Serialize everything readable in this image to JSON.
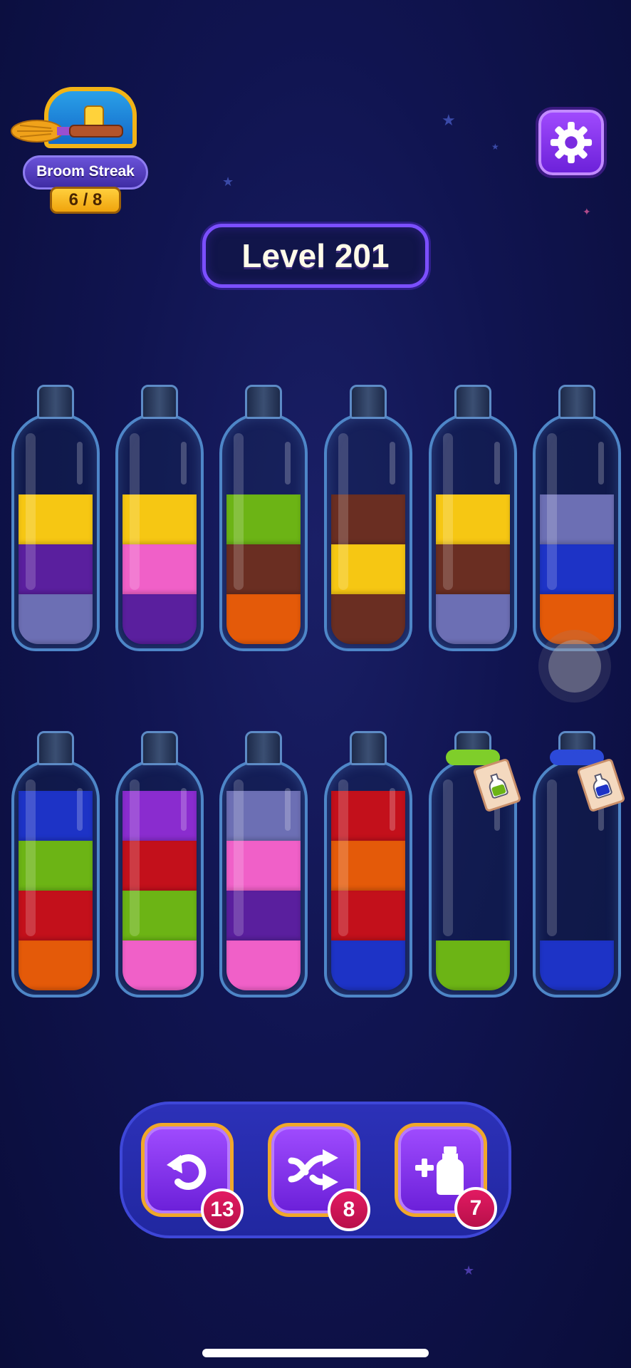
{
  "streak": {
    "label": "Broom Streak",
    "count": "6 / 8"
  },
  "level": {
    "label": "Level 201"
  },
  "colors": {
    "yellow": "#f6c713",
    "purple": "#5a1f9e",
    "periwinkle": "#6c6fb4",
    "pink": "#f060c8",
    "green": "#6cb415",
    "brown": "#6a2e22",
    "orange": "#e45a09",
    "blue": "#1d33c6",
    "red": "#c3101b",
    "violet": "#8a2ccf"
  },
  "bottles": [
    {
      "layers_bottom_to_top": [
        "periwinkle",
        "purple",
        "yellow"
      ]
    },
    {
      "layers_bottom_to_top": [
        "purple",
        "pink",
        "yellow"
      ]
    },
    {
      "layers_bottom_to_top": [
        "orange",
        "brown",
        "green"
      ]
    },
    {
      "layers_bottom_to_top": [
        "brown",
        "yellow",
        "brown"
      ]
    },
    {
      "layers_bottom_to_top": [
        "periwinkle",
        "brown",
        "yellow"
      ]
    },
    {
      "layers_bottom_to_top": [
        "orange",
        "blue",
        "periwinkle"
      ]
    },
    {
      "layers_bottom_to_top": [
        "orange",
        "red",
        "green",
        "blue"
      ]
    },
    {
      "layers_bottom_to_top": [
        "pink",
        "green",
        "red",
        "violet"
      ]
    },
    {
      "layers_bottom_to_top": [
        "pink",
        "purple",
        "pink",
        "periwinkle"
      ]
    },
    {
      "layers_bottom_to_top": [
        "blue",
        "red",
        "orange",
        "red"
      ]
    },
    {
      "layers_bottom_to_top": [
        "green"
      ],
      "tied": true,
      "rope_color": "#7fce2a"
    },
    {
      "layers_bottom_to_top": [
        "blue"
      ],
      "tied": true,
      "rope_color": "#2c49d8"
    }
  ],
  "powerups": {
    "undo": {
      "icon": "undo-icon",
      "count": "13"
    },
    "shuffle": {
      "icon": "shuffle-icon",
      "count": "8"
    },
    "add_bottle": {
      "icon": "add-bottle-icon",
      "count": "7"
    }
  }
}
